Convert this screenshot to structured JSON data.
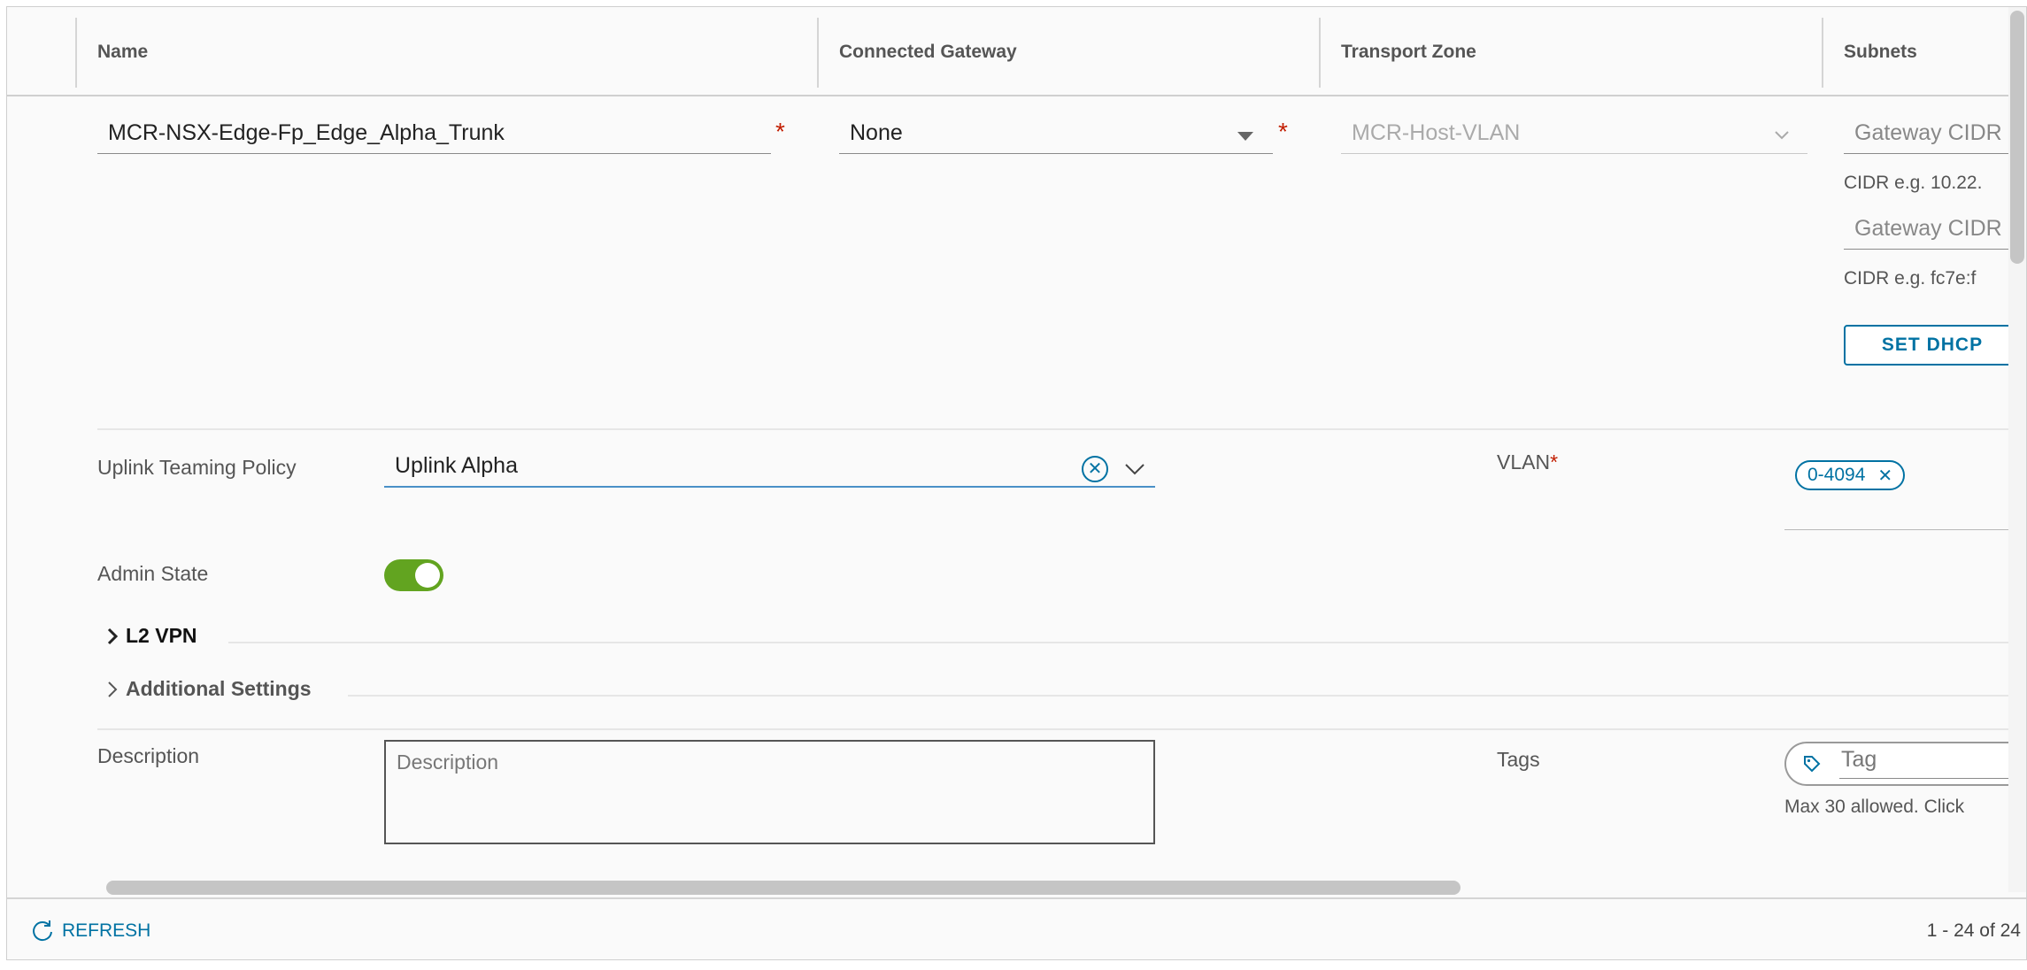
{
  "table": {
    "columns": [
      "Name",
      "Connected Gateway",
      "Transport Zone",
      "Subnets"
    ]
  },
  "row": {
    "name_value": "MCR-NSX-Edge-Fp_Edge_Alpha_Trunk",
    "connected_gateway_value": "None",
    "transport_zone_value": "MCR-Host-VLAN",
    "subnets": {
      "ipv4_placeholder": "Gateway CIDR",
      "ipv4_hint": "CIDR e.g. 10.22.",
      "ipv6_placeholder": "Gateway CIDR",
      "ipv6_hint": "CIDR e.g. fc7e:f",
      "set_dhcp_label": "SET DHCP"
    },
    "required_mark": "*"
  },
  "details": {
    "uplink_label": "Uplink Teaming Policy",
    "uplink_value": "Uplink Alpha",
    "vlan_label": "VLAN",
    "vlan_required": "*",
    "vlan_pill": "0-4094",
    "admin_state_label": "Admin State",
    "admin_state_on": true,
    "l2vpn_label": "L2 VPN",
    "additional_label": "Additional Settings",
    "description_label": "Description",
    "description_placeholder": "Description",
    "tags_label": "Tags",
    "tag_placeholder": "Tag",
    "tags_hint": "Max 30 allowed. Click"
  },
  "footer": {
    "refresh_label": "REFRESH",
    "pagination": "1 - 24 of 24"
  },
  "colors": {
    "accent": "#0072a3",
    "toggle_on": "#62a420",
    "required": "#c21d00"
  }
}
